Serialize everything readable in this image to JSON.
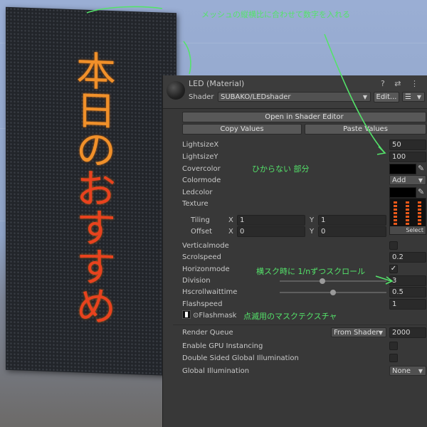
{
  "scene": {
    "led_characters": [
      {
        "char": "本",
        "color": "#f0902a"
      },
      {
        "char": "日",
        "color": "#f0902a"
      },
      {
        "char": "の",
        "color": "#f0902a"
      },
      {
        "char": "お",
        "color": "#e8421e"
      },
      {
        "char": "す",
        "color": "#e8421e"
      },
      {
        "char": "す",
        "color": "#e8421e"
      },
      {
        "char": "め",
        "color": "#e8421e"
      }
    ]
  },
  "header": {
    "title": "LED (Material)",
    "icons": "? ⇄ ⋮",
    "shader_label": "Shader",
    "shader_value": "SUBAKO/LEDshader",
    "edit_label": "Edit...",
    "list_label": "☰"
  },
  "actions": {
    "open_shader_editor": "Open in Shader Editor",
    "copy_values": "Copy Values",
    "paste_values": "Paste Values"
  },
  "props": {
    "lightsize_x": {
      "label": "LightsizeX",
      "value": "50"
    },
    "lightsize_y": {
      "label": "LightsizeY",
      "value": "100"
    },
    "covercolor": {
      "label": "Covercolor"
    },
    "colormode": {
      "label": "Colormode",
      "value": "Add"
    },
    "ledcolor": {
      "label": "Ledcolor"
    },
    "texture": {
      "label": "Texture",
      "select_label": "Select"
    },
    "tiling": {
      "label": "Tiling",
      "x_label": "X",
      "x": "1",
      "y_label": "Y",
      "y": "1"
    },
    "offset": {
      "label": "Offset",
      "x_label": "X",
      "x": "0",
      "y_label": "Y",
      "y": "0"
    },
    "verticalmode": {
      "label": "Verticalmode",
      "checked": false
    },
    "scrolspeed": {
      "label": "Scrolspeed",
      "value": "0.2"
    },
    "horizonmode": {
      "label": "Horizonmode",
      "checked": true,
      "check_glyph": "✓"
    },
    "division": {
      "label": "Division",
      "value": "3",
      "slider_fraction": 0.4
    },
    "hscrollwaittime": {
      "label": "Hscrollwaittime",
      "value": "0.5",
      "slider_fraction": 0.5
    },
    "flashspeed": {
      "label": "Flashspeed",
      "value": "1"
    },
    "flashmask": {
      "label": "Flashmask",
      "prefix": "⊙"
    }
  },
  "advanced": {
    "render_queue": {
      "label": "Render Queue",
      "mode": "From Shader",
      "value": "2000"
    },
    "gpu_instancing": {
      "label": "Enable GPU Instancing",
      "checked": false
    },
    "double_sided_gi": {
      "label": "Double Sided Global Illumination",
      "checked": false
    },
    "global_illumination": {
      "label": "Global Illumination",
      "value": "None"
    }
  },
  "annotations": {
    "top": "メッシュの縦横比に合わせて数字を入れる",
    "cover": "ひからない 部分",
    "division": "横スク時に 1/nずつスクロール",
    "flash": "点滅用のマスクテクスチャ",
    "color": "#54e36a"
  },
  "colors": {
    "inspector_bg": "#383838",
    "led_orange": "#f0902a",
    "led_red": "#e8421e",
    "annotation_green": "#54e36a"
  }
}
